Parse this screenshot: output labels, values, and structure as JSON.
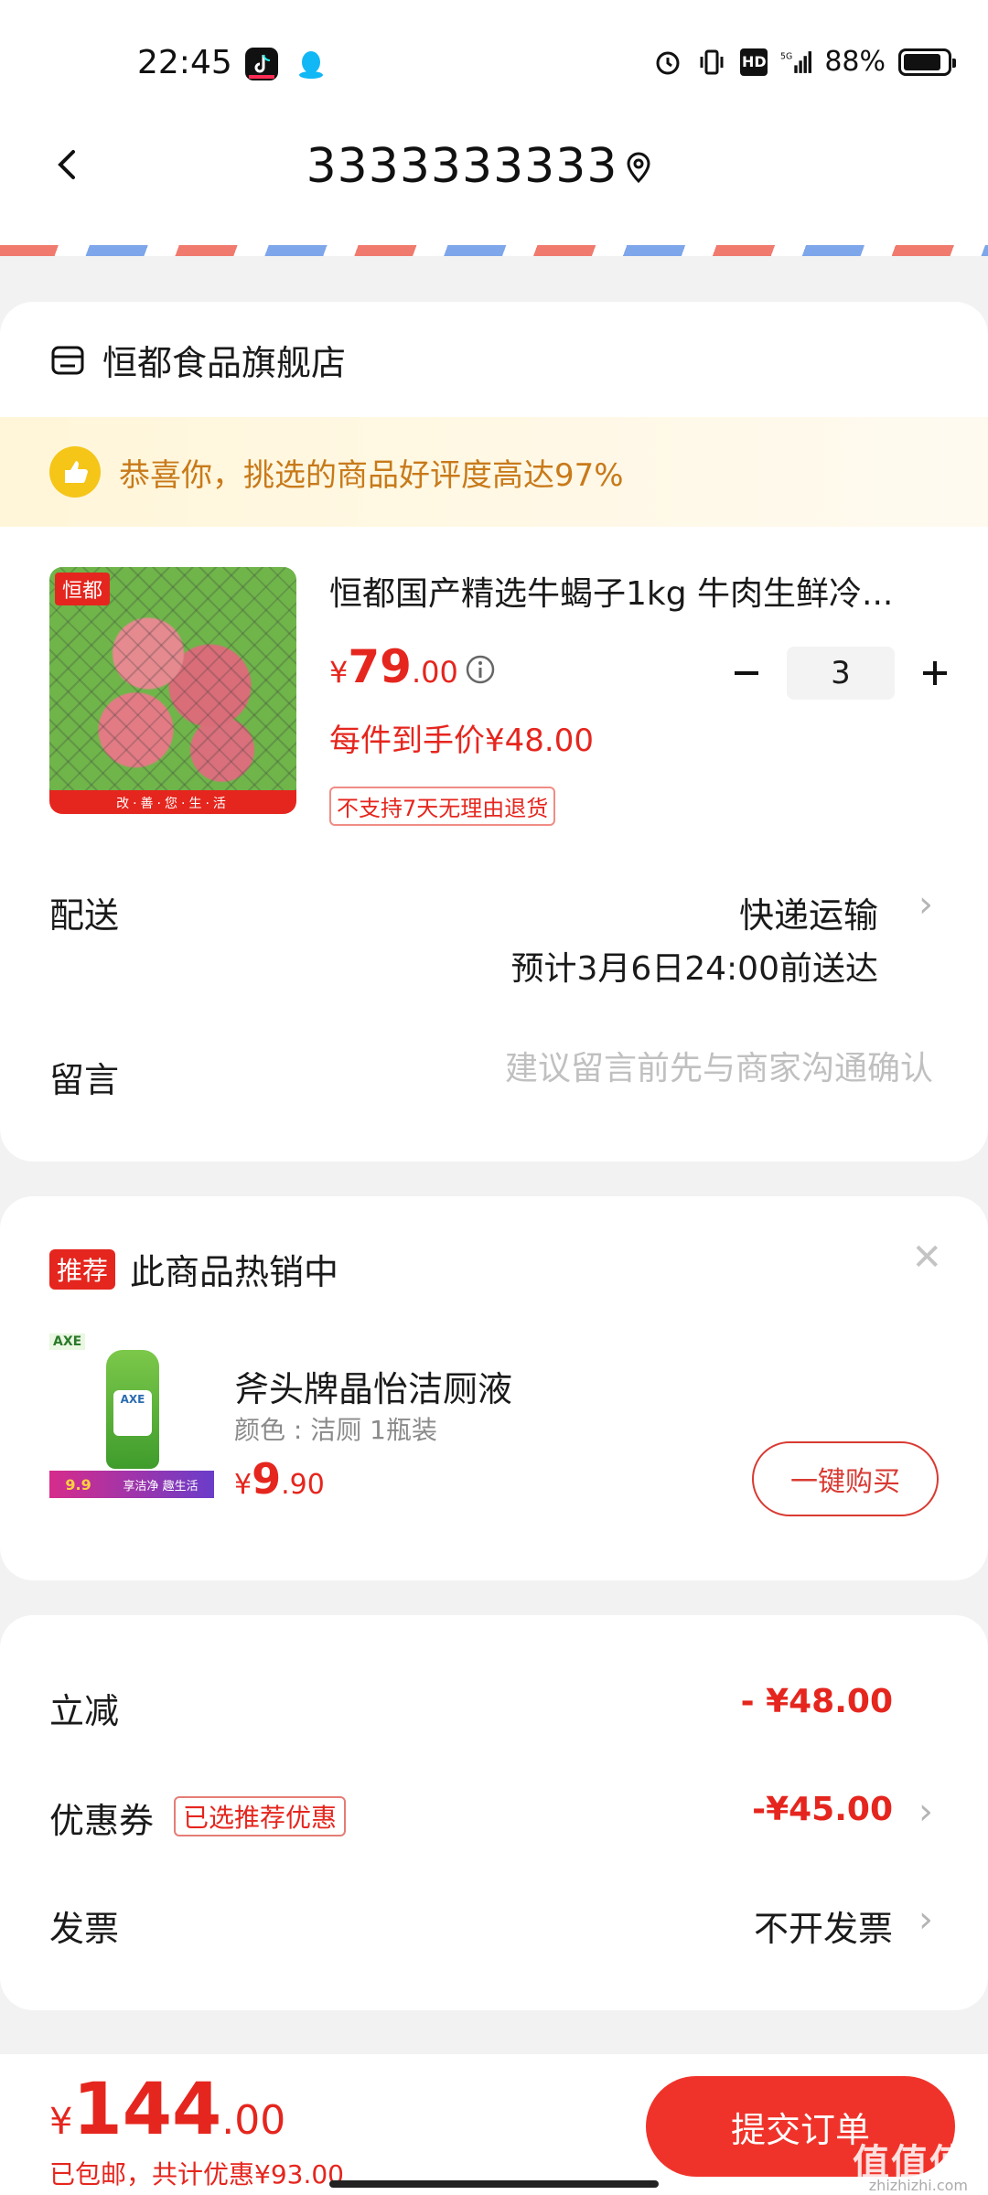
{
  "status_bar": {
    "time": "22:45",
    "network": "⁵ᴳ",
    "battery": "88%",
    "hd": "HD"
  },
  "header": {
    "title": "3333333333"
  },
  "store": {
    "name": "恒都食品旗舰店",
    "banner": "恭喜你，挑选的商品好评度高达97%"
  },
  "product": {
    "title": "恒都国产精选牛蝎子1kg  牛肉生鲜冷...",
    "price_symbol": "¥",
    "price_int": "79",
    "price_dec": ".00",
    "quantity": "3",
    "per_price": "每件到手价¥48.00",
    "return_policy": "不支持7天无理由退货",
    "image_brand": "恒都",
    "image_slogan": "改·善·您·生·活"
  },
  "delivery": {
    "label": "配送",
    "method": "快递运输",
    "eta": "预计3月6日24:00前送达"
  },
  "message": {
    "label": "留言",
    "placeholder": "建议留言前先与商家沟通确认",
    "value": ""
  },
  "recommend": {
    "tag": "推荐",
    "title": "此商品热销中",
    "name": "斧头牌晶怡洁厕液",
    "variant": "颜色 : 洁厕 1瓶装",
    "price_symbol": "¥",
    "price_int": "9",
    "price_dec": ".90",
    "buy_label": "一键购买",
    "image_badge": "AXE",
    "image_promo_left": "9.9",
    "image_promo_right": "享洁净 趣生活"
  },
  "summary": {
    "discount_label": "立减",
    "discount_value": "- ¥48.00",
    "coupon_label": "优惠券",
    "coupon_tag": "已选推荐优惠",
    "coupon_value": "-¥45.00",
    "invoice_label": "发票",
    "invoice_value": "不开发票"
  },
  "footer": {
    "total_symbol": "¥",
    "total_int": "144",
    "total_dec": ".00",
    "note": "已包邮，共计优惠¥93.00",
    "submit_label": "提交订单",
    "watermark": "值值值",
    "watermark_sub": "zhizhizhi.com"
  },
  "colors": {
    "accent": "#e5261e",
    "banner_text": "#c87a1a",
    "background": "#f2f2f2"
  }
}
